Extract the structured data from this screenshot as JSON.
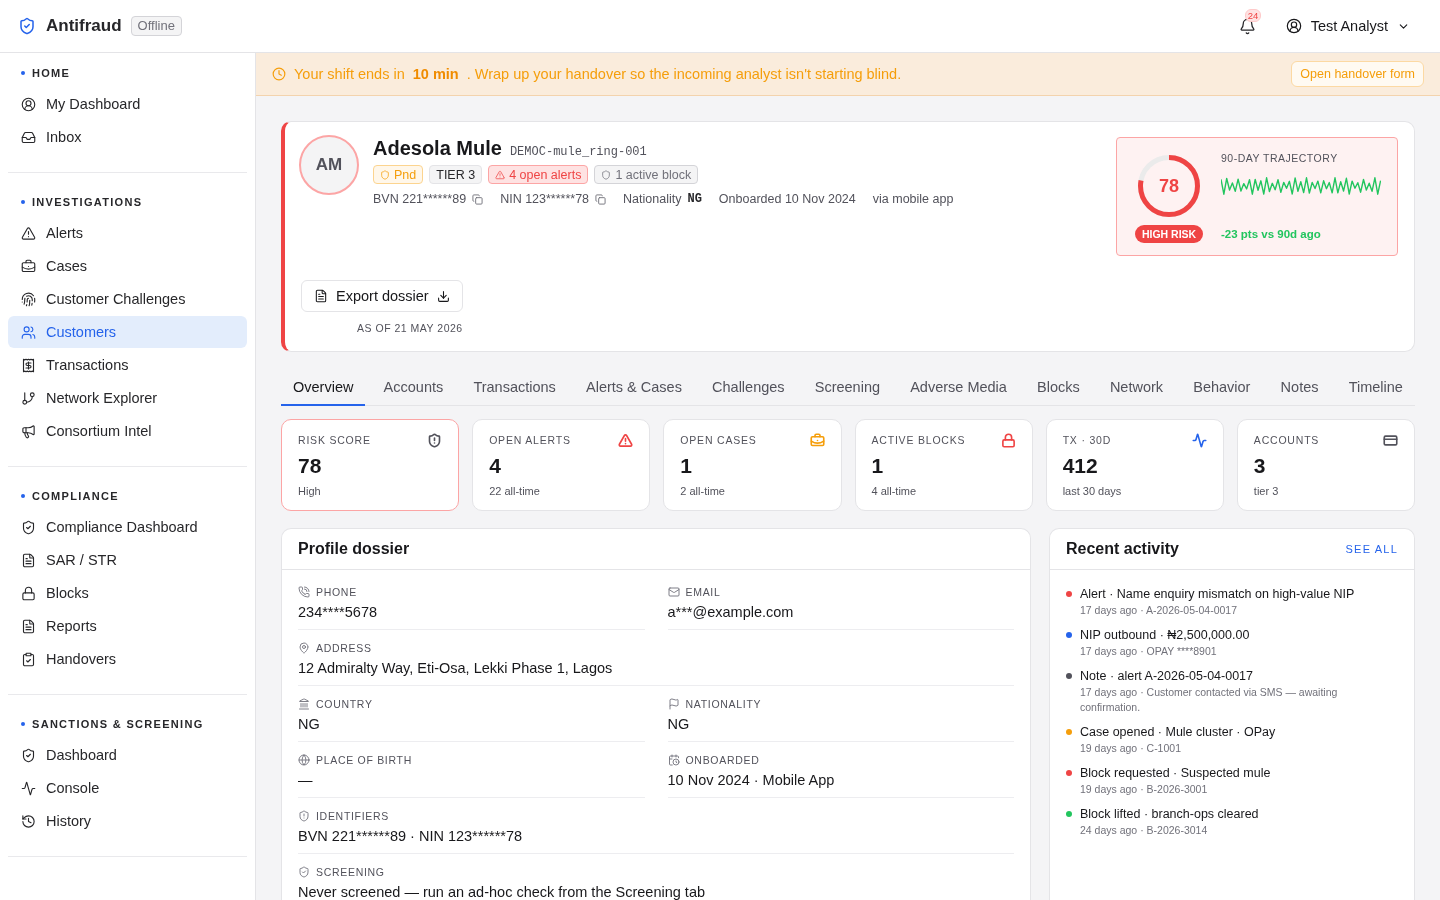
{
  "brand": {
    "name": "Antifraud",
    "status": "Offline"
  },
  "topbar": {
    "notification_count": "24",
    "user": "Test Analyst"
  },
  "sidebar": {
    "sections": [
      {
        "title": "HOME",
        "items": [
          {
            "label": "My Dashboard",
            "selected": false
          },
          {
            "label": "Inbox",
            "selected": false
          }
        ]
      },
      {
        "title": "INVESTIGATIONS",
        "items": [
          {
            "label": "Alerts",
            "selected": false
          },
          {
            "label": "Cases",
            "selected": false
          },
          {
            "label": "Customer Challenges",
            "selected": false
          },
          {
            "label": "Customers",
            "selected": true
          },
          {
            "label": "Transactions",
            "selected": false
          },
          {
            "label": "Network Explorer",
            "selected": false
          },
          {
            "label": "Consortium Intel",
            "selected": false
          }
        ]
      },
      {
        "title": "COMPLIANCE",
        "items": [
          {
            "label": "Compliance Dashboard",
            "selected": false
          },
          {
            "label": "SAR / STR",
            "selected": false
          },
          {
            "label": "Blocks",
            "selected": false
          },
          {
            "label": "Reports",
            "selected": false
          },
          {
            "label": "Handovers",
            "selected": false
          }
        ]
      },
      {
        "title": "SANCTIONS & SCREENING",
        "items": [
          {
            "label": "Dashboard",
            "selected": false
          },
          {
            "label": "Console",
            "selected": false
          },
          {
            "label": "History",
            "selected": false
          }
        ]
      }
    ]
  },
  "banner": {
    "message": "Your shift ends in **10 min** . Wrap up your handover so the incoming analyst isn't starting blind.",
    "action": "Open handover form"
  },
  "customer": {
    "initials": "AM",
    "name": "Adesola Mule",
    "reference": "DEMOC-mule_ring-001",
    "badges": [
      {
        "kind": "warning",
        "label": "Pnd"
      },
      {
        "kind": "neutral",
        "label": "TIER 3"
      },
      {
        "kind": "danger",
        "label": "4 open alerts"
      },
      {
        "kind": "muted",
        "label": "1 active block"
      }
    ],
    "meta": [
      {
        "kind": "copyable",
        "text": "BVN 221******89"
      },
      {
        "kind": "copyable",
        "text": "NIN 123******78"
      },
      {
        "kind": "labeled",
        "text": "Nationality",
        "value": "NG"
      },
      {
        "kind": "plain",
        "text": "Onboarded 10 Nov 2024"
      },
      {
        "kind": "plain",
        "text": "via mobile app"
      }
    ],
    "export_button": "Export dossier",
    "as_of": "AS OF 21 MAY 2026"
  },
  "risk": {
    "score": "78",
    "level": 0.78,
    "band": "HIGH RISK",
    "trajectory_title": "90-DAY TRAJECTORY",
    "trajectory_change": "-23 pts vs 90d ago"
  },
  "tabs": [
    {
      "label": "Overview",
      "selected": true
    },
    {
      "label": "Accounts",
      "selected": false
    },
    {
      "label": "Transactions",
      "selected": false
    },
    {
      "label": "Alerts & Cases",
      "selected": false
    },
    {
      "label": "Challenges",
      "selected": false
    },
    {
      "label": "Screening",
      "selected": false
    },
    {
      "label": "Adverse Media",
      "selected": false
    },
    {
      "label": "Blocks",
      "selected": false
    },
    {
      "label": "Network",
      "selected": false
    },
    {
      "label": "Behavior",
      "selected": false
    },
    {
      "label": "Notes",
      "selected": false
    },
    {
      "label": "Timeline",
      "selected": false
    }
  ],
  "stats": [
    {
      "label": "RISK SCORE",
      "value": "78",
      "note": "High",
      "color": "#52525b",
      "highlighted": true
    },
    {
      "label": "OPEN ALERTS",
      "value": "4",
      "note": "22 all-time",
      "color": "#ef4444",
      "highlighted": false
    },
    {
      "label": "OPEN CASES",
      "value": "1",
      "note": "2 all-time",
      "color": "#f59e0b",
      "highlighted": false
    },
    {
      "label": "ACTIVE BLOCKS",
      "value": "1",
      "note": "4 all-time",
      "color": "#ef4444",
      "highlighted": false
    },
    {
      "label": "TX · 30D",
      "value": "412",
      "note": "last 30 days",
      "color": "#2563eb",
      "highlighted": false
    },
    {
      "label": "ACCOUNTS",
      "value": "3",
      "note": "tier 3",
      "color": "#52525b",
      "highlighted": false
    }
  ],
  "dossier": {
    "title": "Profile dossier",
    "fields": [
      {
        "label": "PHONE",
        "value": "234****5678",
        "wide": false
      },
      {
        "label": "EMAIL",
        "value": "a***@example.com",
        "wide": false
      },
      {
        "label": "ADDRESS",
        "value": "12 Admiralty Way, Eti-Osa, Lekki Phase 1, Lagos",
        "wide": true
      },
      {
        "label": "COUNTRY",
        "value": "NG",
        "wide": false
      },
      {
        "label": "NATIONALITY",
        "value": "NG",
        "wide": false
      },
      {
        "label": "PLACE OF BIRTH",
        "value": "—",
        "wide": false
      },
      {
        "label": "ONBOARDED",
        "value": "10 Nov 2024 · Mobile App",
        "wide": false
      },
      {
        "label": "IDENTIFIERS",
        "value": "BVN 221******89 · NIN 123******78",
        "wide": true
      },
      {
        "label": "SCREENING",
        "value": "Never screened — run an ad-hoc check from the Screening tab",
        "wide": true
      }
    ]
  },
  "activity": {
    "title": "Recent activity",
    "action": "SEE ALL",
    "items": [
      {
        "title": "Alert · Name enquiry mismatch on high-value NIP",
        "detail": "17 days ago · A-2026-05-04-0017",
        "color": "#ef4444"
      },
      {
        "title": "NIP outbound · ₦2,500,000.00",
        "detail": "17 days ago · OPAY ****8901",
        "color": "#2563eb"
      },
      {
        "title": "Note · alert A-2026-05-04-0017",
        "detail": "17 days ago · Customer contacted via SMS — awaiting confirmation.",
        "color": "#52525b"
      },
      {
        "title": "Case opened · Mule cluster · OPay",
        "detail": "19 days ago · C-1001",
        "color": "#f59e0b"
      },
      {
        "title": "Block requested · Suspected mule",
        "detail": "19 days ago · B-2026-3001",
        "color": "#ef4444"
      },
      {
        "title": "Block lifted · branch-ops cleared",
        "detail": "24 days ago · B-2026-3014",
        "color": "#22c55e"
      }
    ]
  }
}
